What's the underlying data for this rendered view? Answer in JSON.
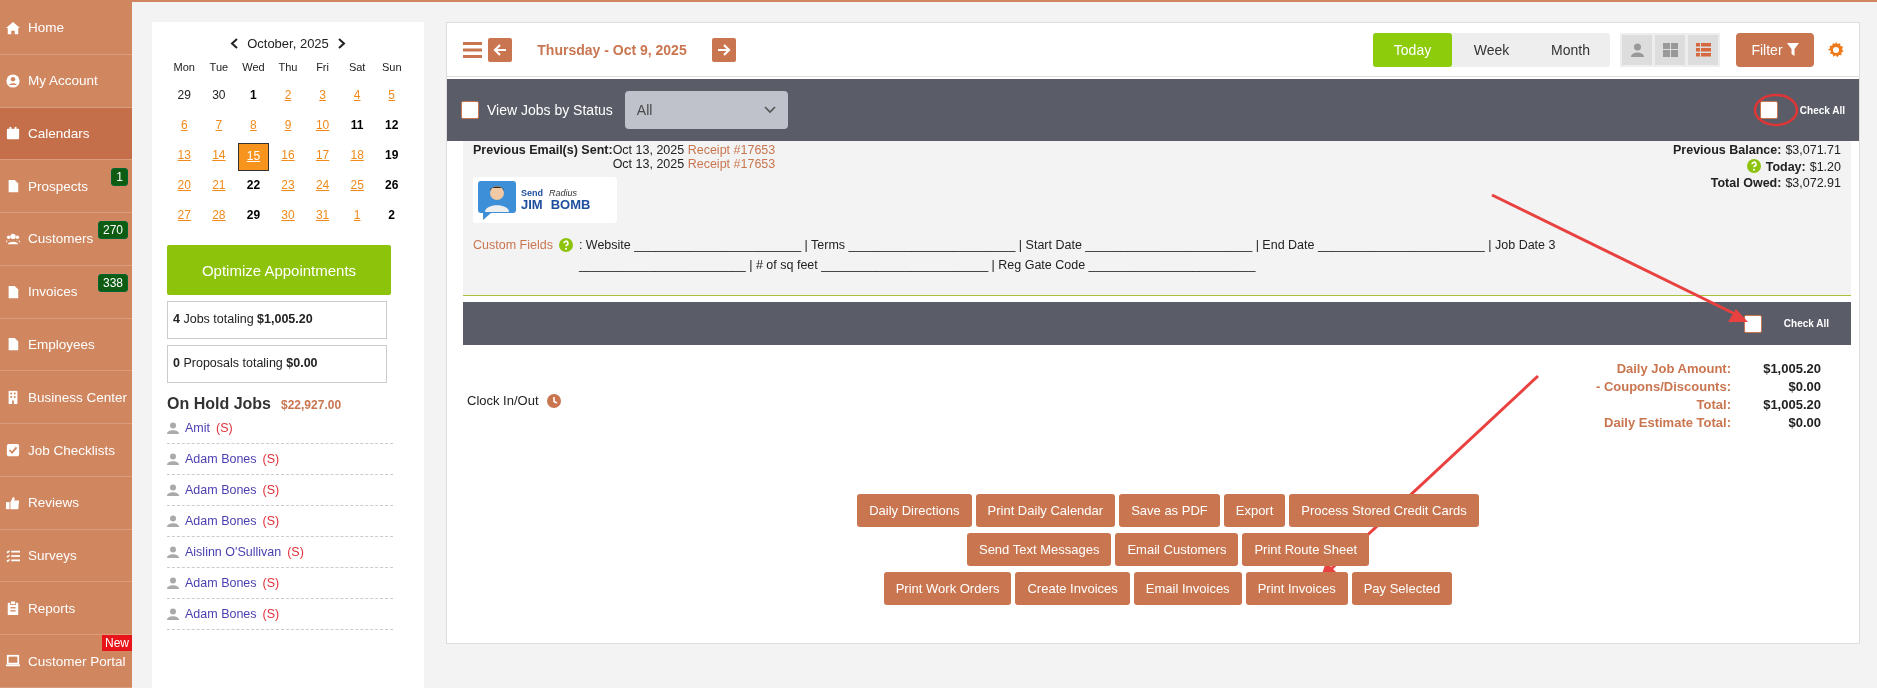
{
  "sidebar": {
    "items": [
      {
        "label": "Home",
        "selected": false
      },
      {
        "label": "My Account",
        "selected": false
      },
      {
        "label": "Calendars",
        "selected": true
      },
      {
        "label": "Prospects",
        "selected": false,
        "badge": {
          "text": "1",
          "kind": "count"
        }
      },
      {
        "label": "Customers",
        "selected": false,
        "badge": {
          "text": "270",
          "kind": "count"
        }
      },
      {
        "label": "Invoices",
        "selected": false,
        "badge": {
          "text": "338",
          "kind": "count"
        }
      },
      {
        "label": "Employees",
        "selected": false
      },
      {
        "label": "Business Center",
        "selected": false
      },
      {
        "label": "Job Checklists",
        "selected": false
      },
      {
        "label": "Reviews",
        "selected": false
      },
      {
        "label": "Surveys",
        "selected": false
      },
      {
        "label": "Reports",
        "selected": false
      },
      {
        "label": "Customer Portal",
        "selected": false,
        "badge": {
          "text": "New",
          "kind": "new"
        }
      }
    ]
  },
  "calendar": {
    "month": "October, 2025",
    "weekdays": [
      "Mon",
      "Tue",
      "Wed",
      "Thu",
      "Fri",
      "Sat",
      "Sun"
    ],
    "days": [
      {
        "day": "29",
        "kind": "outside",
        "selected": false
      },
      {
        "day": "30",
        "kind": "outside",
        "selected": false
      },
      {
        "day": "1",
        "kind": "plain",
        "selected": false
      },
      {
        "day": "2",
        "kind": "link",
        "selected": false
      },
      {
        "day": "3",
        "kind": "link",
        "selected": false
      },
      {
        "day": "4",
        "kind": "link",
        "selected": false
      },
      {
        "day": "5",
        "kind": "link",
        "selected": false
      },
      {
        "day": "6",
        "kind": "link",
        "selected": false
      },
      {
        "day": "7",
        "kind": "link",
        "selected": false
      },
      {
        "day": "8",
        "kind": "link",
        "selected": false
      },
      {
        "day": "9",
        "kind": "link",
        "selected": false
      },
      {
        "day": "10",
        "kind": "link",
        "selected": false
      },
      {
        "day": "11",
        "kind": "plain",
        "selected": false
      },
      {
        "day": "12",
        "kind": "plain",
        "selected": false
      },
      {
        "day": "13",
        "kind": "link",
        "selected": false
      },
      {
        "day": "14",
        "kind": "link",
        "selected": false
      },
      {
        "day": "15",
        "kind": "link",
        "selected": true
      },
      {
        "day": "16",
        "kind": "link",
        "selected": false
      },
      {
        "day": "17",
        "kind": "link",
        "selected": false
      },
      {
        "day": "18",
        "kind": "link",
        "selected": false
      },
      {
        "day": "19",
        "kind": "plain",
        "selected": false
      },
      {
        "day": "20",
        "kind": "link",
        "selected": false
      },
      {
        "day": "21",
        "kind": "link",
        "selected": false
      },
      {
        "day": "22",
        "kind": "plain",
        "selected": false
      },
      {
        "day": "23",
        "kind": "link",
        "selected": false
      },
      {
        "day": "24",
        "kind": "link",
        "selected": false
      },
      {
        "day": "25",
        "kind": "link",
        "selected": false
      },
      {
        "day": "26",
        "kind": "plain",
        "selected": false
      },
      {
        "day": "27",
        "kind": "link",
        "selected": false
      },
      {
        "day": "28",
        "kind": "link",
        "selected": false
      },
      {
        "day": "29",
        "kind": "plain",
        "selected": false
      },
      {
        "day": "30",
        "kind": "link",
        "selected": false
      },
      {
        "day": "31",
        "kind": "link",
        "selected": false
      },
      {
        "day": "1",
        "kind": "link",
        "selected": false
      },
      {
        "day": "2",
        "kind": "plain",
        "selected": false
      }
    ]
  },
  "optimize_button": "Optimize Appointments",
  "summaries": [
    "**4** Jobs totaling **$1,005.20**",
    "**0** Proposals totaling **$0.00**"
  ],
  "on_hold": {
    "title": "On Hold Jobs",
    "total": "$22,927.00",
    "jobs": [
      {
        "name": "Amit",
        "tag": "(S)"
      },
      {
        "name": "Adam Bones",
        "tag": "(S)"
      },
      {
        "name": "Adam Bones",
        "tag": "(S)"
      },
      {
        "name": "Adam Bones",
        "tag": "(S)"
      },
      {
        "name": "Aislinn O'Sullivan",
        "tag": "(S)"
      },
      {
        "name": "Adam Bones",
        "tag": "(S)"
      },
      {
        "name": "Adam Bones",
        "tag": "(S)"
      }
    ]
  },
  "toolbar": {
    "date": "Thursday - Oct 9, 2025",
    "views": [
      {
        "label": "Today",
        "selected": true
      },
      {
        "label": "Week",
        "selected": false
      },
      {
        "label": "Month",
        "selected": false
      }
    ],
    "layouts": [
      {
        "selected": false
      },
      {
        "selected": false
      },
      {
        "selected": true
      }
    ],
    "filter": "Filter"
  },
  "status_bar": {
    "checked": false,
    "label": "View Jobs by Status",
    "select": {
      "value": "All",
      "disabled": true
    },
    "check_all": {
      "label": "Check All",
      "checked": false
    }
  },
  "job": {
    "emails_label": "Previous Email(s) Sent:",
    "emails": [
      {
        "date": "Oct 13, 2025",
        "receipt": "Receipt #17653"
      },
      {
        "date": "Oct 13, 2025",
        "receipt": "Receipt #17653"
      }
    ],
    "balances": [
      {
        "label": "Previous Balance:",
        "value": "$3,071.71",
        "help": false
      },
      {
        "label": "Today:",
        "value": "$1.20",
        "help": true
      },
      {
        "label": "Total Owed:",
        "value": "$3,072.91",
        "help": false
      }
    ],
    "logo": {
      "top": "Send",
      "small": "Radius",
      "left": "JIM",
      "right": "BOMB"
    },
    "custom_fields_label": "Custom Fields",
    "custom_fields": ": Website ________________________ | Terms ________________________ | Start Date ________________________ | End Date ________________________ | Job Date 3 ________________________ | # of sq feet ________________________ | Reg Gate Code ________________________"
  },
  "section_bar": {
    "check_all": {
      "label": "Check All",
      "checked": false
    }
  },
  "clock": "Clock In/Out",
  "totals": [
    {
      "label": "Daily Job Amount:",
      "value": "$1,005.20"
    },
    {
      "label": "- Coupons/Discounts:",
      "value": "$0.00"
    },
    {
      "label": "Total:",
      "value": "$1,005.20"
    },
    {
      "label": "Daily Estimate Total:",
      "value": "$0.00"
    }
  ],
  "action_buttons": [
    [
      "Daily Directions",
      "Print Daily Calendar",
      "Save as PDF",
      "Export",
      "Process Stored Credit Cards"
    ],
    [
      "Send Text Messages",
      "Email Customers",
      "Print Route Sheet"
    ],
    [
      "Print Work Orders",
      "Create Invoices",
      "Email Invoices",
      "Print Invoices",
      "Pay Selected"
    ]
  ],
  "annotations": [
    {
      "kind": "circle"
    },
    {
      "kind": "arrow"
    },
    {
      "kind": "arrow"
    }
  ]
}
